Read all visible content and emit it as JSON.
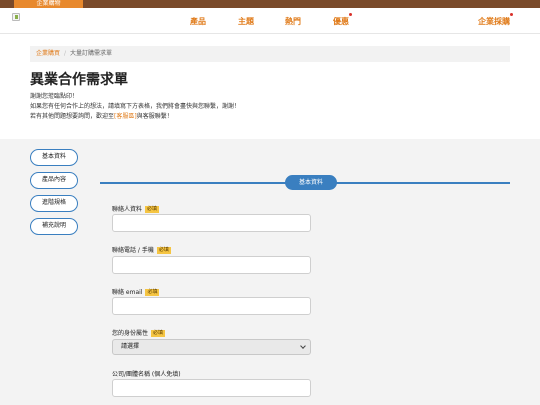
{
  "top_tab": {
    "label": "企業購物"
  },
  "nav": {
    "items": [
      {
        "label": "產品",
        "dot": false
      },
      {
        "label": "主題",
        "dot": false
      },
      {
        "label": "熱門",
        "dot": false
      },
      {
        "label": "優惠",
        "dot": true
      },
      {
        "label": "企業採購",
        "dot": true
      }
    ]
  },
  "breadcrumb": {
    "home": "企業購買",
    "separator": "/",
    "current": "大量訂購需求單"
  },
  "page": {
    "title": "異業合作需求單",
    "intro_line1": "謝謝您蒞臨點印！",
    "intro_line2": "如果您有任何合作上的想法，請填寫下方表格，我們將會盡快與您聯繫，謝謝！",
    "intro_line3_a": "若有其他問題想要詢問，歡迎至",
    "intro_line3_link": "[客服區]",
    "intro_line3_b": "與客服聯繫！"
  },
  "sidebar": {
    "items": [
      {
        "label": "基本資料"
      },
      {
        "label": "產品內容"
      },
      {
        "label": "進階規格"
      },
      {
        "label": "補充說明"
      }
    ]
  },
  "section": {
    "title": "基本資料"
  },
  "form": {
    "required_badge": "必填",
    "contact_name_label": "聯絡人資料",
    "phone_label": "聯絡電話 / 手機",
    "email_label": "聯絡 email",
    "identity_label": "您的身份屬性",
    "identity_selected": "請選擇",
    "company_label": "公司/團體名稱 (個人免填)"
  },
  "colors": {
    "brand_orange": "#e07b1a",
    "accent_blue": "#3a7fc0",
    "top_bar": "#7a4a2a"
  }
}
